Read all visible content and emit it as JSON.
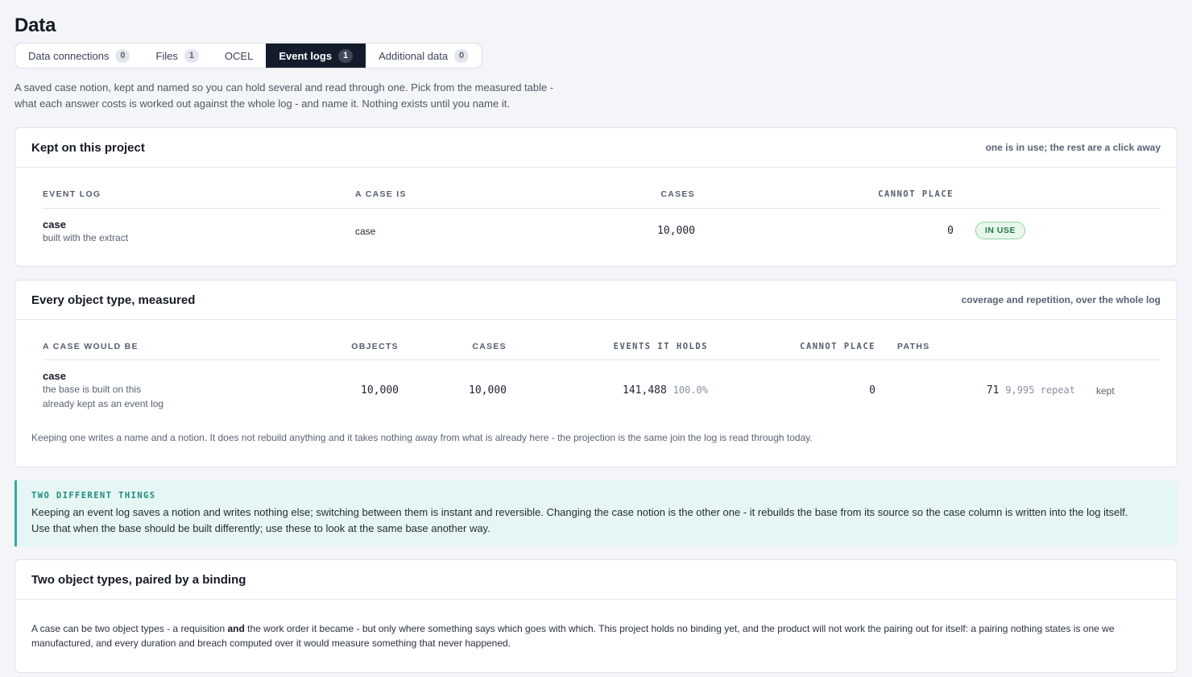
{
  "page": {
    "title": "Data"
  },
  "tabs": [
    {
      "label": "Data connections",
      "count": "0",
      "active": false
    },
    {
      "label": "Files",
      "count": "1",
      "active": false
    },
    {
      "label": "OCEL",
      "count": null,
      "active": false
    },
    {
      "label": "Event logs",
      "count": "1",
      "active": true
    },
    {
      "label": "Additional data",
      "count": "0",
      "active": false
    }
  ],
  "intro": {
    "line1": "A saved case notion, kept and named so you can hold several and read through one. Pick from the measured table -",
    "line2": "what each answer costs is worked out against the whole log - and name it. Nothing exists until you name it."
  },
  "kept": {
    "title": "Kept on this project",
    "note": "one is in use; the rest are a click away",
    "headers": {
      "event_log": "EVENT LOG",
      "case_is": "A CASE IS",
      "cases": "CASES",
      "cannot_place": "CANNOT PLACE"
    },
    "row": {
      "name": "case",
      "sub": "built with the extract",
      "case_is": "case",
      "cases": "10,000",
      "cannot_place": "0",
      "badge": "IN USE"
    }
  },
  "measured": {
    "title": "Every object type, measured",
    "note": "coverage and repetition, over the whole log",
    "headers": {
      "case_would_be": "A CASE WOULD BE",
      "objects": "OBJECTS",
      "cases": "CASES",
      "events": "EVENTS IT HOLDS",
      "cannot_place": "CANNOT PLACE",
      "paths": "PATHS"
    },
    "row": {
      "name": "case",
      "sub1": "the base is built on this",
      "sub2": "already kept as an event log",
      "objects": "10,000",
      "cases": "10,000",
      "events": "141,488",
      "events_pct": "100.0%",
      "cannot_place": "0",
      "paths": "71",
      "paths_repeat": "9,995 repeat",
      "status": "kept"
    },
    "footnote": "Keeping one writes a name and a notion. It does not rebuild anything and it takes nothing away from what is already here - the projection is the same join the log is read through today."
  },
  "callout": {
    "title": "TWO DIFFERENT THINGS",
    "line1": "Keeping an event log saves a notion and writes nothing else; switching between them is instant and reversible. Changing the case notion is the other one - it rebuilds the base from its source so the case column is written into the log itself.",
    "line2": "Use that when the base should be built differently; use these to look at the same base another way."
  },
  "binding": {
    "title": "Two object types, paired by a binding",
    "text_a": "A case can be two object types - a requisition ",
    "text_bold": "and",
    "text_b": " the work order it became - but only where something says which goes with which. This project holds no binding yet, and the product will not work the pairing out for itself: a pairing nothing states is one we manufactured, and every duration and breach computed over it would measure something that never happened."
  }
}
